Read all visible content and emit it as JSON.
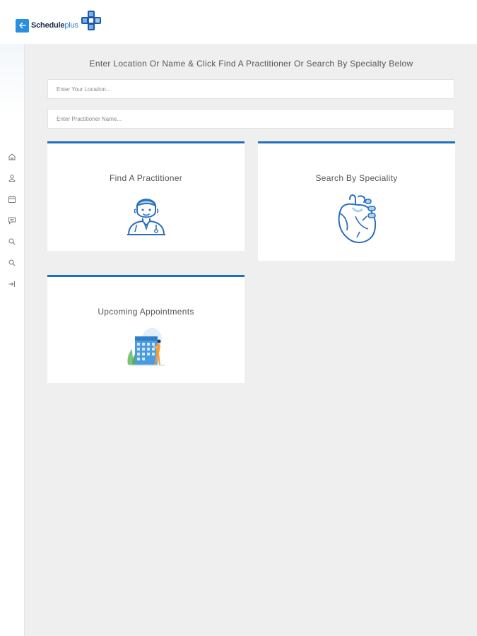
{
  "brand": {
    "name_bold": "Schedule",
    "name_light": "plus"
  },
  "sidebar": {
    "items": [
      {
        "icon": "home-icon"
      },
      {
        "icon": "user-icon"
      },
      {
        "icon": "calendar-icon"
      },
      {
        "icon": "message-icon"
      },
      {
        "icon": "search-icon"
      },
      {
        "icon": "search-icon"
      },
      {
        "icon": "logout-icon"
      }
    ]
  },
  "main": {
    "headline": "Enter Location Or Name & Click Find A Practitioner Or Search By Specialty Below",
    "location_input": {
      "placeholder": "Enter Your Location...",
      "value": ""
    },
    "name_input": {
      "placeholder": "Enter Practitioner Name...",
      "value": ""
    },
    "cards": {
      "find": {
        "title": "Find A Practitioner",
        "icon": "doctor-icon"
      },
      "specialty": {
        "title": "Search By Speciality",
        "icon": "heart-icon"
      },
      "appointments": {
        "title": "Upcoming Appointments",
        "icon": "calendar-illustration"
      }
    }
  },
  "colors": {
    "accent": "#1f6fc0",
    "brand_blue": "#2b8fe0",
    "background": "#efefef"
  }
}
